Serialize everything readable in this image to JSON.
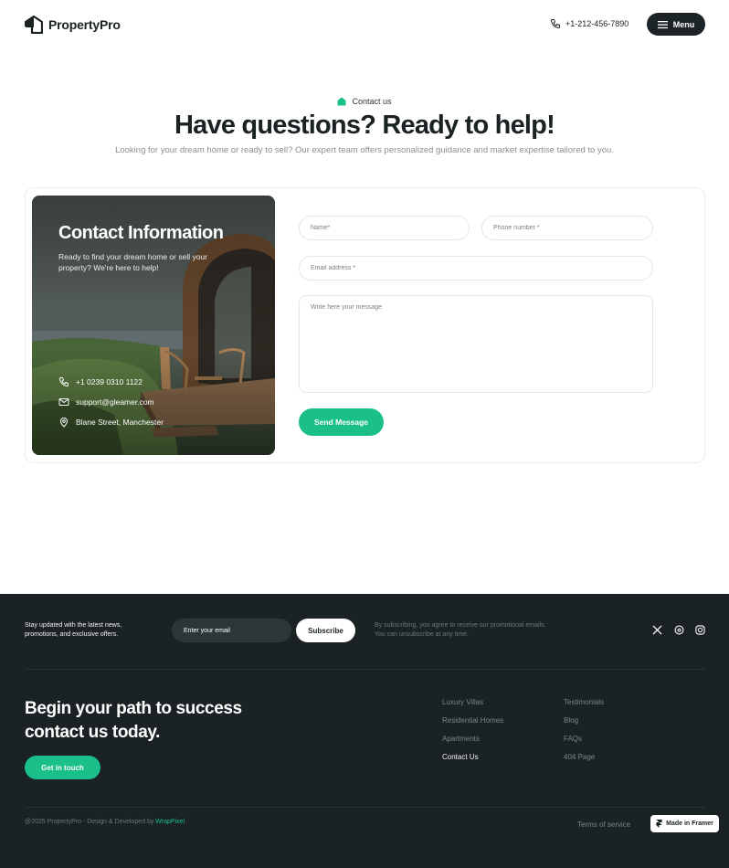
{
  "header": {
    "logo_text": "PropertyPro",
    "phone": "+1-212-456-7890",
    "menu_label": "Menu"
  },
  "hero": {
    "badge": "Contact us",
    "title": "Have questions? Ready to help!",
    "subtitle": "Looking for your dream home or ready to sell? Our expert team offers personalized guidance and market expertise tailored to you."
  },
  "contact_info": {
    "title": "Contact Information",
    "description": "Ready to find your dream home or sell your property? We're here to help!",
    "phone": "+1 0239 0310 1122",
    "email": "support@gleamer.com",
    "address": "Blane Street, Manchester"
  },
  "form": {
    "name_placeholder": "Name*",
    "phone_placeholder": "Phone number *",
    "email_placeholder": "Email address *",
    "message_placeholder": "Write here your message",
    "submit_label": "Send Message"
  },
  "footer": {
    "newsletter_text": "Stay updated with the latest news, promotions, and exclusive offers.",
    "email_placeholder": "Enter your email",
    "subscribe_label": "Subscribe",
    "subscribe_note": "By subscribing, you agree to receive our promotional emails. You can unsubscribe  at any time.",
    "social_icons": [
      "x-icon",
      "threads-icon",
      "instagram-icon"
    ],
    "cta_heading": "Begin your path to  success contact us today.",
    "cta_button": "Get in touch",
    "links_col1": [
      "Luxury Villas",
      "Residential Homes",
      "Apartments",
      "Contact Us"
    ],
    "links_col2": [
      "Testimonials",
      "Blog",
      "FAQs",
      "404 Page"
    ],
    "copyright_prefix": "@2025 PropertyPro - Design & Developed by ",
    "copyright_brand": "WrapPixel",
    "terms": "Terms of service",
    "made_in": "Made in Framer"
  },
  "colors": {
    "accent": "#1bbf8a",
    "dark": "#1a2224",
    "text_muted": "#8a8f92"
  }
}
